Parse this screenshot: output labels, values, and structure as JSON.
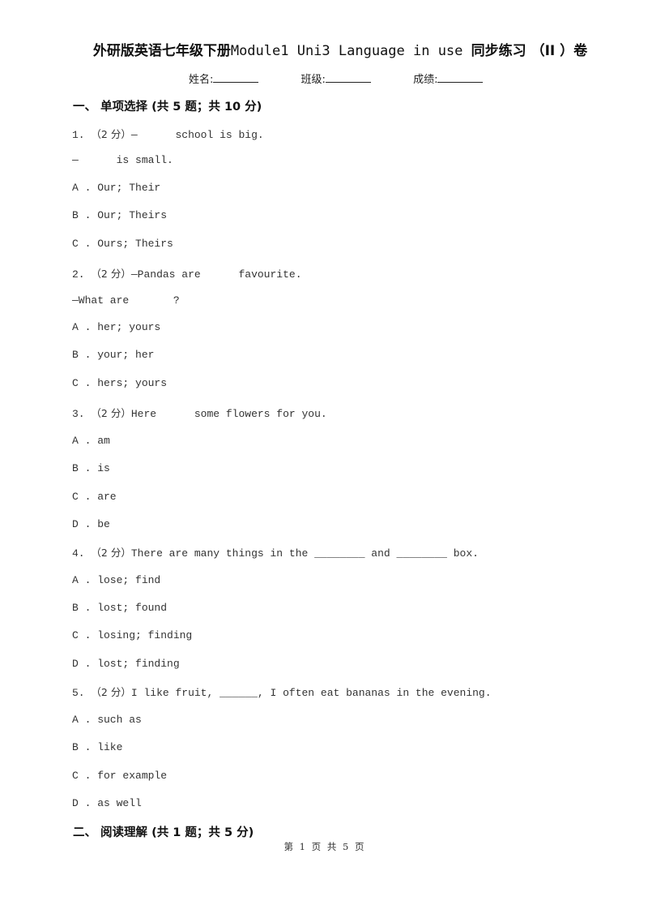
{
  "document": {
    "title_cjk_prefix": "外研版英语七年级下册",
    "title_latin": "Module1 Uni3 Language in use",
    "title_cjk_suffix": "同步练习 （II ）卷",
    "info_fields": [
      {
        "label": "姓名:"
      },
      {
        "label": "班级:"
      },
      {
        "label": "成绩:"
      }
    ]
  },
  "sections": [
    {
      "heading": "一、  单项选择 (共 5 题；共 10 分)"
    },
    {
      "heading": "二、  阅读理解 (共 1 题；共 5 分)"
    }
  ],
  "questions": [
    {
      "number": "1.",
      "score": "（2 分）",
      "stem": "—      school is big.",
      "stem2": "—      is small.",
      "options": [
        "A . Our; Their",
        "B . Our; Theirs",
        "C . Ours; Theirs"
      ]
    },
    {
      "number": "2.",
      "score": "（2 分）",
      "stem": "—Pandas are      favourite.",
      "stem2": "—What are       ?",
      "options": [
        "A . her; yours",
        "B . your; her",
        "C . hers; yours"
      ]
    },
    {
      "number": "3.",
      "score": "（2 分）",
      "stem": "Here      some flowers for you.",
      "options": [
        "A . am",
        "B . is",
        "C . are",
        "D . be"
      ]
    },
    {
      "number": "4.",
      "score": "（2 分）",
      "stem": "There are many things in the ________ and ________ box.",
      "options": [
        "A . lose; find",
        "B . lost; found",
        "C . losing; finding",
        "D . lost; finding"
      ]
    },
    {
      "number": "5.",
      "score": "（2 分）",
      "stem": "I like fruit, ______, I often eat bananas in the evening.",
      "options": [
        "A . such as",
        "B . like",
        "C . for example",
        "D . as well"
      ]
    }
  ],
  "footer": {
    "text": "第 1 页 共 5 页"
  }
}
